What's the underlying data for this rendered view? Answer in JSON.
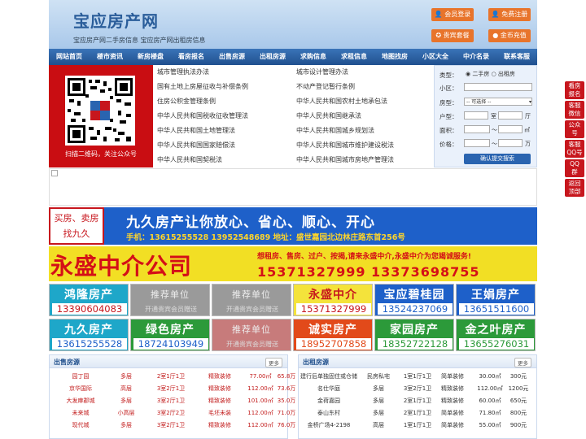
{
  "header": {
    "site_title": "宝应房产网",
    "tagline": "宝应房产网二手房信息    宝应房产网出租房信息",
    "buttons": {
      "login": "会员登录",
      "register": "免费注册",
      "package": "贵宾套餐",
      "recharge": "金币充值"
    }
  },
  "nav": [
    "网站首页",
    "楼市资讯",
    "新房楼盘",
    "看房报名",
    "出售房源",
    "出租房源",
    "求购信息",
    "求租信息",
    "地图找房",
    "小区大全",
    "中介名录",
    "联系客服"
  ],
  "qr": {
    "caption": "扫描二维码，关注公众号"
  },
  "laws_left": [
    "城市管理执法办法",
    "国有土地上房屋征收与补偿条例",
    "住房公积金管理条例",
    "中华人民共和国税收征收管理法",
    "中华人民共和国土地管理法",
    "中华人民共和国国家赔偿法",
    "中华人民共和国契税法"
  ],
  "laws_right": [
    "城市设计管理办法",
    "不动产登记暂行条例",
    "中华人民共和国农村土地承包法",
    "中华人民共和国继承法",
    "中华人民共和国城乡规划法",
    "中华人民共和国城市维护建设税法",
    "中华人民共和国城市房地产管理法"
  ],
  "search": {
    "type_label": "类型：",
    "type_second": "二手房",
    "type_rent": "出租房",
    "community_label": "小区：",
    "property_label": "房型：",
    "property_select": "-- 可选择 --",
    "layout_label": "户型：",
    "room_unit": "室",
    "hall_unit": "厅",
    "area_label": "面积：",
    "area_unit": "㎡",
    "area_sep": "～",
    "price_label": "价格：",
    "price_unit": "万",
    "price_sep": "～",
    "submit": "确认提交搜索"
  },
  "jiujiu": {
    "left_line1": "买房、卖房",
    "left_line2": "找九久",
    "slogan": "九久房产让你放心、省心、顺心、开心",
    "contact": "手机：13615255528   13952548689    地址：盛世嘉园北边林庄路东首256号"
  },
  "yongsheng": {
    "name": "永盛中介公司",
    "slogan": "想租房、售房、过户、按揭,请来永盛中介,永盛中介为您竭诚服务!",
    "phones": "15371327999   13373698755"
  },
  "ads": [
    {
      "name": "鸿隆房产",
      "phone": "13390604083",
      "bg": "#1ea7c9",
      "fg": "#c7161d"
    },
    {
      "name": "推荐单位",
      "phone": "开通贵宾会员赠送",
      "bg": "#9a9a9a",
      "fg": "#ddd",
      "gray": true
    },
    {
      "name": "推荐单位",
      "phone": "开通贵宾会员赠送",
      "bg": "#9a9a9a",
      "fg": "#ddd",
      "gray": true
    },
    {
      "name": "永盛中介",
      "phone": "15371327999",
      "bg": "#f4e33b",
      "fg": "#c7161d",
      "dark": true
    },
    {
      "name": "宝应碧桂园",
      "phone": "13524237069",
      "bg": "#1e60c9",
      "fg": "#1e60c9"
    },
    {
      "name": "王娟房产",
      "phone": "13651511600",
      "bg": "#1e60c9",
      "fg": "#1e60c9"
    },
    {
      "name": "九久房产",
      "phone": "13615255528",
      "bg": "#1ea7c9",
      "fg": "#1e60c9"
    },
    {
      "name": "绿色房产",
      "phone": "18724103949",
      "bg": "#2c9a3a",
      "fg": "#1e60c9"
    },
    {
      "name": "推荐单位",
      "phone": "开通贵宾会员赠送",
      "bg": "#c77b7b",
      "fg": "#ddd",
      "gray": true
    },
    {
      "name": "诚实房产",
      "phone": "18952707858",
      "bg": "#e24a1a",
      "fg": "#e24a1a"
    },
    {
      "name": "家园房产",
      "phone": "18352722128",
      "bg": "#2c9a3a",
      "fg": "#2c9a3a"
    },
    {
      "name": "金之叶房产",
      "phone": "13655276031",
      "bg": "#2c9a3a",
      "fg": "#2c9a3a"
    }
  ],
  "sell": {
    "title": "出售房源",
    "more": "更多",
    "rows": [
      [
        "园丁园",
        "多层",
        "2室1厅1卫",
        "精致装修",
        "77.00㎡",
        "65.8万"
      ],
      [
        "京华国际",
        "高层",
        "3室2厅1卫",
        "精致装修",
        "112.00㎡",
        "73.6万"
      ],
      [
        "大发麻郡城",
        "多层",
        "3室2厅1卫",
        "精致装修",
        "101.00㎡",
        "35.0万"
      ],
      [
        "未来城",
        "小高层",
        "3室2厅2卫",
        "毛坯未装",
        "112.00㎡",
        "71.0万"
      ],
      [
        "现代城",
        "多层",
        "3室2厅1卫",
        "精致装修",
        "112.00㎡",
        "76.0万"
      ]
    ]
  },
  "rent": {
    "title": "出租房源",
    "more": "更多",
    "rows": [
      [
        "建行后单独固住或仓储",
        "民房私宅",
        "1室1厅1卫",
        "简单装修",
        "30.00㎡",
        "300元"
      ],
      [
        "名仕华庭",
        "多层",
        "3室2厅1卫",
        "精致装修",
        "112.00㎡",
        "1200元"
      ],
      [
        "金荷嘉园",
        "多层",
        "2室1厅1卫",
        "精致装修",
        "60.00㎡",
        "650元"
      ],
      [
        "泰山东村",
        "多层",
        "2室1厅1卫",
        "简单装修",
        "71.80㎡",
        "800元"
      ],
      [
        "金桥广场4-2198",
        "高层",
        "1室1厅1卫",
        "简单装修",
        "55.00㎡",
        "900元"
      ]
    ]
  },
  "sidebar": [
    {
      "l1": "看房",
      "l2": "报名"
    },
    {
      "l1": "客服",
      "l2": "微信"
    },
    {
      "l1": "公众",
      "l2": "号"
    },
    {
      "l1": "客服",
      "l2": "QQ号"
    },
    {
      "l1": "QQ",
      "l2": "群"
    },
    {
      "l1": "返回",
      "l2": "顶部"
    }
  ]
}
